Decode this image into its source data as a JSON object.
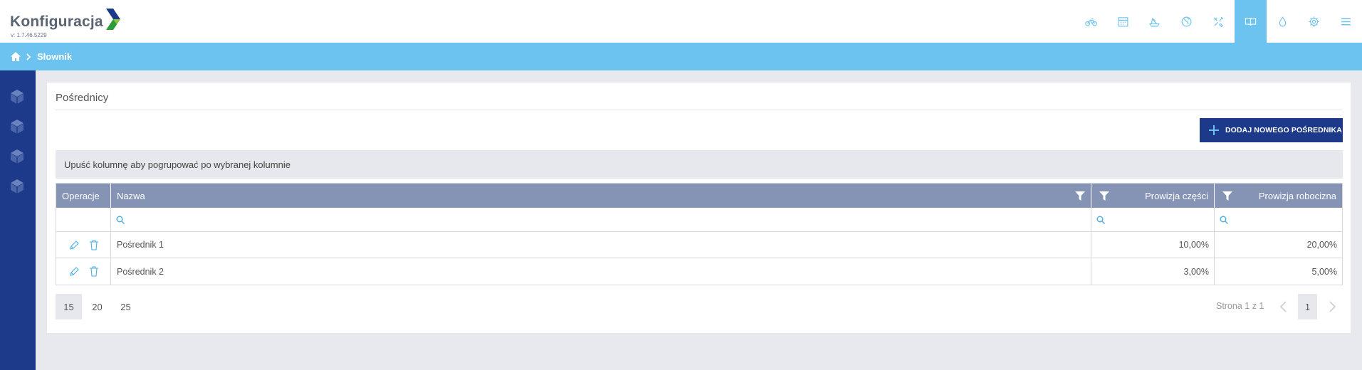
{
  "app": {
    "title": "Konfiguracja",
    "version": "v: 1.7.46.5229"
  },
  "nav": {
    "icons": [
      "bicycle-icon",
      "calendar-icon",
      "boat-icon",
      "globe-icon",
      "tools-icon",
      "book-icon",
      "drop-icon",
      "gear-icon",
      "menu-icon"
    ],
    "active": "book-icon"
  },
  "breadcrumb": {
    "current": "Słownik"
  },
  "sidebar": {
    "items": [
      "box-icon",
      "box-icon",
      "box-icon",
      "box-icon"
    ]
  },
  "page": {
    "title": "Pośrednicy",
    "add_button": "DODAJ NOWEGO POŚREDNIKA",
    "group_panel": "Upuść kolumnę aby pogrupować po wybranej kolumnie"
  },
  "table": {
    "columns": [
      "Operacje",
      "Nazwa",
      "Prowizja części",
      "Prowizja robocizna"
    ],
    "rows": [
      {
        "name": "Pośrednik 1",
        "parts": "10,00%",
        "labor": "20,00%"
      },
      {
        "name": "Pośrednik 2",
        "parts": "3,00%",
        "labor": "5,00%"
      }
    ]
  },
  "pager": {
    "sizes": [
      "15",
      "20",
      "25"
    ],
    "selected_size": "15",
    "info": "Strona 1 z 1",
    "current": "1"
  },
  "colors": {
    "brand_blue": "#1d3a8a",
    "accent": "#6cc3ef",
    "header": "#8594b4"
  }
}
